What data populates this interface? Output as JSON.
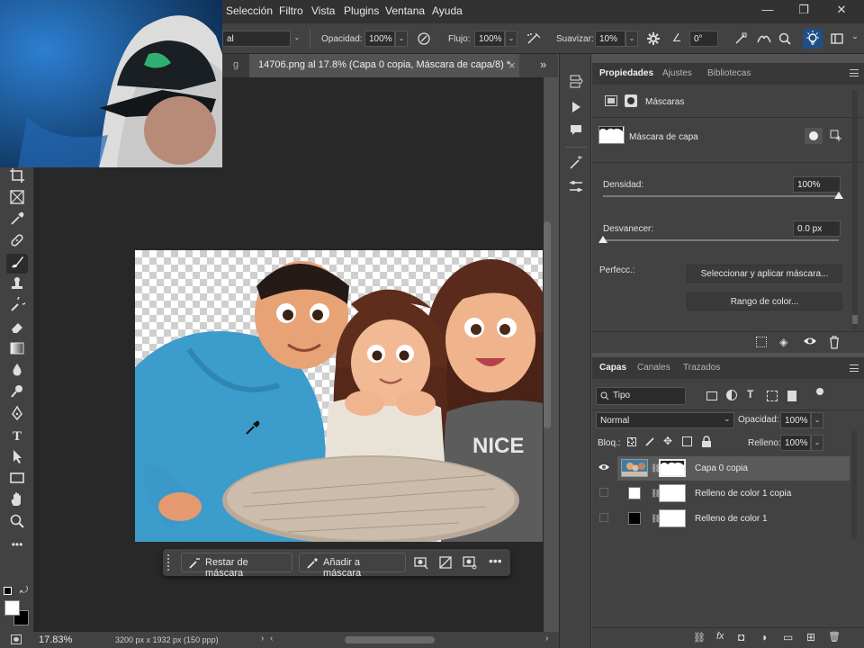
{
  "menubar": {
    "items": [
      "Selección",
      "Filtro",
      "Vista",
      "Plugins",
      "Ventana",
      "Ayuda"
    ],
    "window_controls": [
      "—",
      "❐",
      "✕"
    ]
  },
  "options": {
    "mode_value": "al",
    "opacity_label": "Opacidad:",
    "opacity_value": "100%",
    "flow_label": "Flujo:",
    "flow_value": "100%",
    "smooth_label": "Suavizar:",
    "smooth_value": "10%",
    "angle_icon": "∠",
    "angle_value": "0°"
  },
  "tabs": {
    "prev": "g",
    "active": "14706.png al 17.8% (Capa 0 copia, Máscara de capa/8) *",
    "close": "×",
    "overflow": "»"
  },
  "properties": {
    "tabs": [
      "Propiedades",
      "Ajustes",
      "Bibliotecas"
    ],
    "section_label": "Máscaras",
    "mask_label": "Máscara de capa",
    "density_label": "Densidad:",
    "density_value": "100%",
    "density_fraction": 1.0,
    "feather_label": "Desvanecer:",
    "feather_value": "0.0 px",
    "feather_fraction": 0.0,
    "refine_label": "Perfecc.:",
    "select_mask_button": "Seleccionar y aplicar máscara...",
    "color_range_button": "Rango de color..."
  },
  "layers": {
    "tabs": [
      "Capas",
      "Canales",
      "Trazados"
    ],
    "filter_label": "Tipo",
    "blend_mode": "Normal",
    "opacity_label": "Opacidad:",
    "opacity_value": "100%",
    "lock_label": "Bloq.:",
    "fill_label": "Relleno:",
    "fill_value": "100%",
    "rows": [
      {
        "name": "Capa 0 copia",
        "visible": true,
        "selected": true
      },
      {
        "name": "Relleno de color 1 copia",
        "visible": false,
        "selected": false
      },
      {
        "name": "Relleno de color 1",
        "visible": false,
        "selected": false
      }
    ],
    "footer_icons": [
      "⛓",
      "fx",
      "◘",
      "◑",
      "▭",
      "⊞",
      "🗑"
    ]
  },
  "taskbar": {
    "subtract_label": "Restar de máscara",
    "add_label": "Añadir a máscara"
  },
  "status": {
    "zoom": "17.83%",
    "doc_info": "3200 px x 1932 px (150 ppp)"
  },
  "colors": {
    "background": "#535353",
    "panel": "#424242",
    "canvas": "#282828",
    "accent": "#2d8ceb"
  }
}
